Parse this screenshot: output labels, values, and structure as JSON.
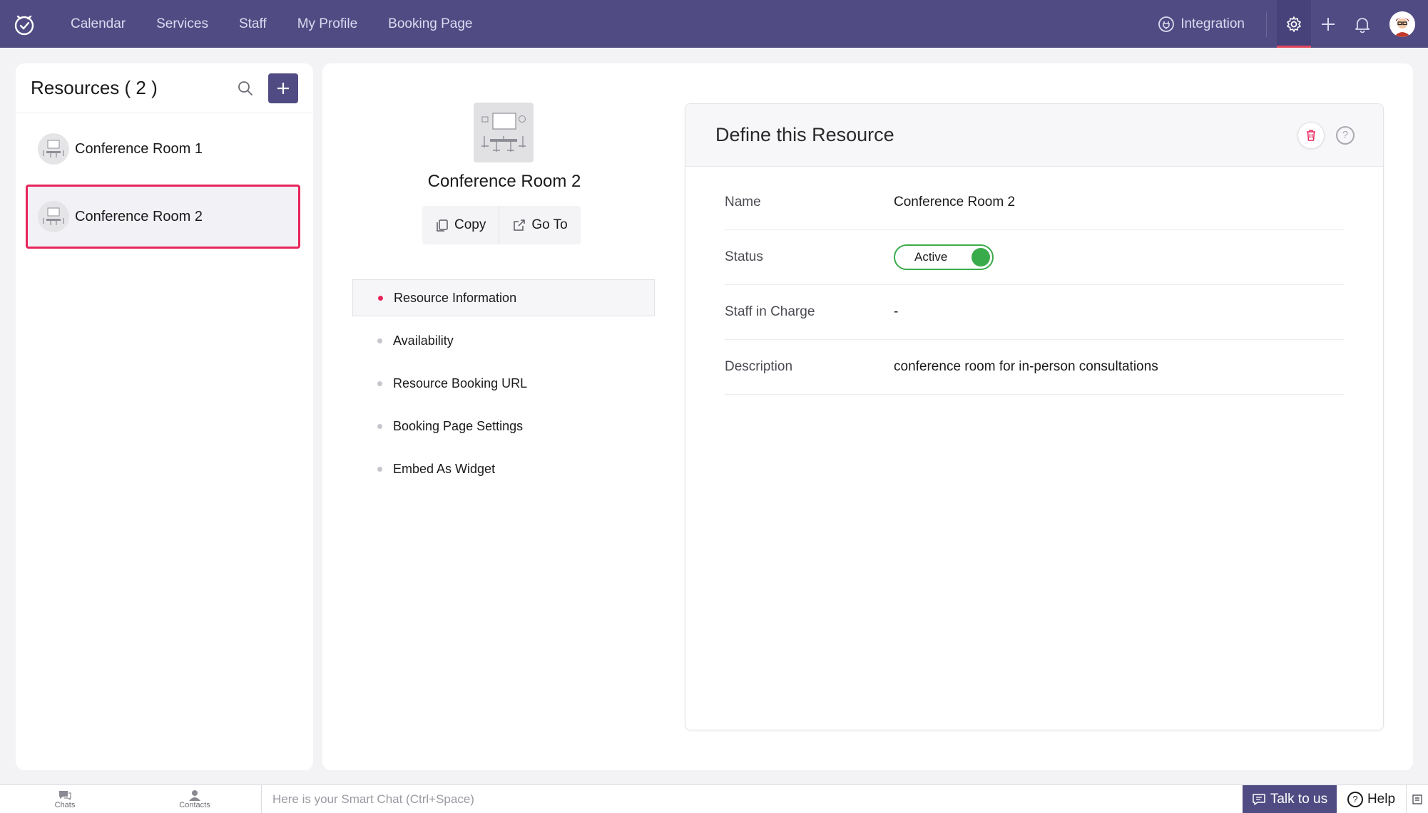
{
  "nav": {
    "links": [
      "Calendar",
      "Services",
      "Staff",
      "My Profile",
      "Booking Page"
    ],
    "integration_label": "Integration"
  },
  "resources": {
    "title": "Resources ( 2 )",
    "items": [
      {
        "name": "Conference Room 1"
      },
      {
        "name": "Conference Room 2"
      }
    ]
  },
  "profile": {
    "name": "Conference Room 2",
    "copy_label": "Copy",
    "goto_label": "Go To"
  },
  "menu": {
    "items": [
      "Resource Information",
      "Availability",
      "Resource Booking URL",
      "Booking Page Settings",
      "Embed As Widget"
    ],
    "active_index": 0
  },
  "define": {
    "title": "Define this Resource",
    "fields": {
      "name_label": "Name",
      "name_value": "Conference Room 2",
      "status_label": "Status",
      "status_value": "Active",
      "staff_label": "Staff in Charge",
      "staff_value": "-",
      "description_label": "Description",
      "description_value": "conference room for in-person consultations"
    }
  },
  "bottombar": {
    "chats_label": "Chats",
    "contacts_label": "Contacts",
    "chat_placeholder": "Here is your Smart Chat (Ctrl+Space)",
    "talk_label": "Talk to us",
    "help_label": "Help"
  },
  "colors": {
    "brand": "#514b83",
    "accent": "#e8245b",
    "status_active": "#3aab4b"
  },
  "icons": [
    "app-logo-icon",
    "integration-icon",
    "gear-icon",
    "plus-icon",
    "bell-icon",
    "search-icon",
    "trash-icon",
    "help-icon",
    "copy-icon",
    "external-link-icon",
    "chat-icon",
    "contacts-icon"
  ]
}
